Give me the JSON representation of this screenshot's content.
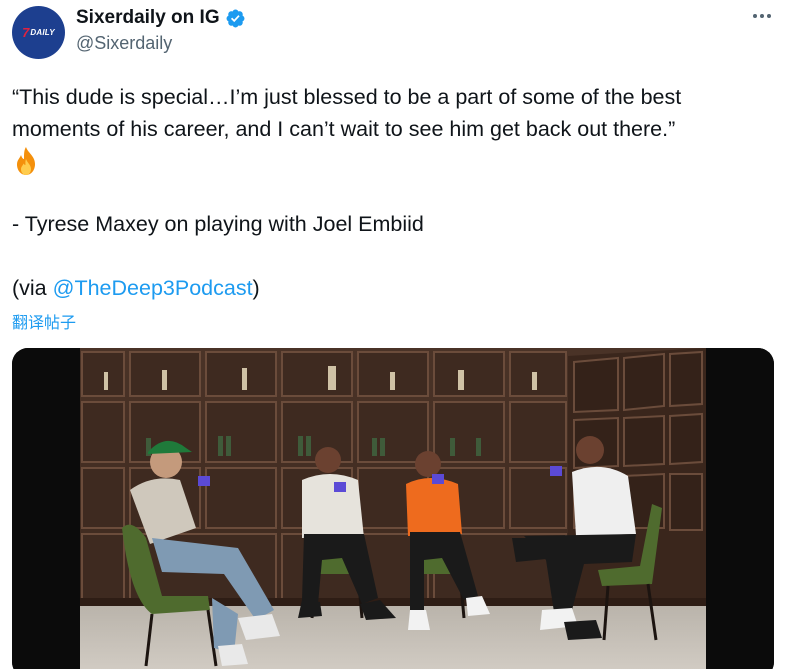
{
  "author": {
    "display_name": "Sixerdaily on IG",
    "handle": "@Sixerdaily",
    "avatar_text": "DAILY",
    "avatar_mark": "7",
    "avatar_color": "#1d3f8f",
    "verified": true,
    "verified_color": "#1d9bf0"
  },
  "more_icon": "more-horizontal-icon",
  "tweet": {
    "line1": "“This dude is special…I’m just blessed to be a part of some of the best",
    "line2": "moments of his career, and I can’t wait to see him get back out there.”",
    "emoji": "fire-emoji",
    "attribution": "- Tyrese Maxey on playing with Joel Embiid",
    "via_prefix": "(via ",
    "via_mention": "@TheDeep3Podcast",
    "via_suffix": ")"
  },
  "translate_label": "翻译帖子",
  "link_color": "#1d9bf0"
}
